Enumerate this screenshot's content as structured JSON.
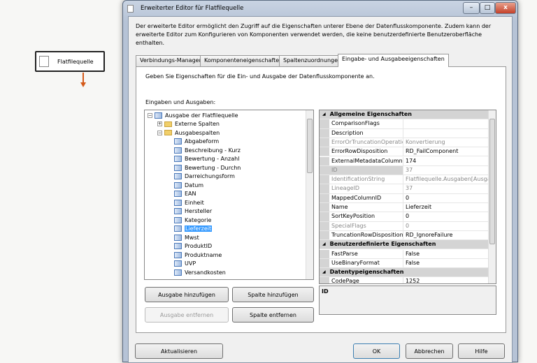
{
  "canvas": {
    "node_label": "Flatfilequelle"
  },
  "window": {
    "title": "Erweiterter Editor für Flatfilequelle",
    "minimize": "–",
    "maximize": "□",
    "close": "x",
    "description": "Der erweiterte Editor ermöglicht den Zugriff auf die Eigenschaften unterer Ebene der Datenflusskomponente. Zudem kann der erweiterte Editor zum Konfigurieren von Komponenten verwendet werden, die keine benutzerdefinierte Benutzeroberfläche enthalten."
  },
  "tabs": [
    {
      "label": "Verbindungs-Manager"
    },
    {
      "label": "Komponenteneigenschaften"
    },
    {
      "label": "Spaltenzuordnungen"
    },
    {
      "label": "Eingabe- und Ausgabeeigenschaften",
      "active": true
    }
  ],
  "panel": {
    "intro": "Geben Sie Eigenschaften für die Ein- und Ausgabe der Datenflusskomponente an.",
    "tree_label": "Eingaben und Ausgaben:"
  },
  "tree": {
    "root": "Ausgabe der Flatfilequelle",
    "external": "Externe Spalten",
    "output_columns": "Ausgabespalten",
    "columns": [
      "Abgabeform",
      "Beschreibung - Kurz",
      "Bewertung - Anzahl",
      "Bewertung - Durchn",
      "Darreichungsform",
      "Datum",
      "EAN",
      "Einheit",
      "Hersteller",
      "Kategorie",
      "Lieferzeit",
      "Mwst",
      "ProduktID",
      "Produktname",
      "UVP",
      "Versandkosten"
    ],
    "selected": "Lieferzeit"
  },
  "properties": [
    {
      "category": "Allgemeine Eigenschaften"
    },
    {
      "name": "ComparisonFlags",
      "value": ""
    },
    {
      "name": "Description",
      "value": ""
    },
    {
      "name": "ErrorOrTruncationOperation",
      "value": "Konvertierung",
      "readonly": true
    },
    {
      "name": "ErrorRowDisposition",
      "value": "RD_FailComponent"
    },
    {
      "name": "ExternalMetadataColumnID",
      "value": "174"
    },
    {
      "name": "ID",
      "value": "37",
      "readonly": true,
      "selected": true
    },
    {
      "name": "IdentificationString",
      "value": "Flatfilequelle.Ausgaben[Ausgabe",
      "readonly": true
    },
    {
      "name": "LineageID",
      "value": "37",
      "readonly": true
    },
    {
      "name": "MappedColumnID",
      "value": "0"
    },
    {
      "name": "Name",
      "value": "Lieferzeit"
    },
    {
      "name": "SortKeyPosition",
      "value": "0"
    },
    {
      "name": "SpecialFlags",
      "value": "0",
      "readonly": true
    },
    {
      "name": "TruncationRowDisposition",
      "value": "RD_IgnoreFailure"
    },
    {
      "category": "Benutzerdefinierte Eigenschaften"
    },
    {
      "name": "FastParse",
      "value": "False"
    },
    {
      "name": "UseBinaryFormat",
      "value": "False"
    },
    {
      "category": "Datentypeigenschaften"
    },
    {
      "name": "CodePage",
      "value": "1252"
    }
  ],
  "property_description": "ID",
  "buttons": {
    "add_output": "Ausgabe hinzufügen",
    "add_column": "Spalte hinzufügen",
    "remove_output": "Ausgabe entfernen",
    "remove_column": "Spalte entfernen",
    "refresh": "Aktualisieren",
    "ok": "OK",
    "cancel": "Abbrechen",
    "help": "Hilfe"
  }
}
